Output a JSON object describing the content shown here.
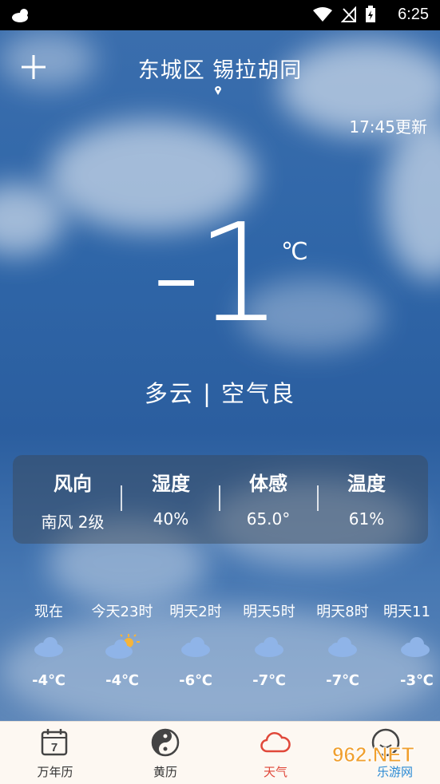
{
  "status_bar": {
    "time": "6:25"
  },
  "header": {
    "location": "东城区 锡拉胡同",
    "update_time": "17:45更新"
  },
  "current": {
    "temperature": "-1",
    "unit": "℃",
    "condition": "多云 | 空气良"
  },
  "details": [
    {
      "label": "风向",
      "value": "南风 2级"
    },
    {
      "label": "湿度",
      "value": "40%"
    },
    {
      "label": "体感",
      "value": "65.0°"
    },
    {
      "label": "温度",
      "value": "61%"
    }
  ],
  "hourly": [
    {
      "time": "现在",
      "icon": "cloud-icon",
      "temp": "-4℃"
    },
    {
      "time": "今天23时",
      "icon": "partly-sunny-icon",
      "temp": "-4℃"
    },
    {
      "time": "明天2时",
      "icon": "cloud-icon",
      "temp": "-6℃"
    },
    {
      "time": "明天5时",
      "icon": "cloud-icon",
      "temp": "-7℃"
    },
    {
      "time": "明天8时",
      "icon": "cloud-icon",
      "temp": "-7℃"
    },
    {
      "time": "明天11",
      "icon": "cloud-icon",
      "temp": "-3℃"
    }
  ],
  "nav": [
    {
      "label": "万年历",
      "icon": "calendar-icon",
      "calendar_day": "7"
    },
    {
      "label": "黄历",
      "icon": "yin-yang-icon"
    },
    {
      "label": "天气",
      "icon": "weather-cloud-icon",
      "active": true
    },
    {
      "label": "",
      "icon": "face-icon"
    }
  ],
  "watermark": {
    "text": "962.NET",
    "subtext": "乐游网"
  },
  "colors": {
    "active_nav": "#e0483a",
    "sky": "#2f66a8",
    "cloud_icon": "#8fb4e8",
    "sun": "#f5b43a"
  }
}
